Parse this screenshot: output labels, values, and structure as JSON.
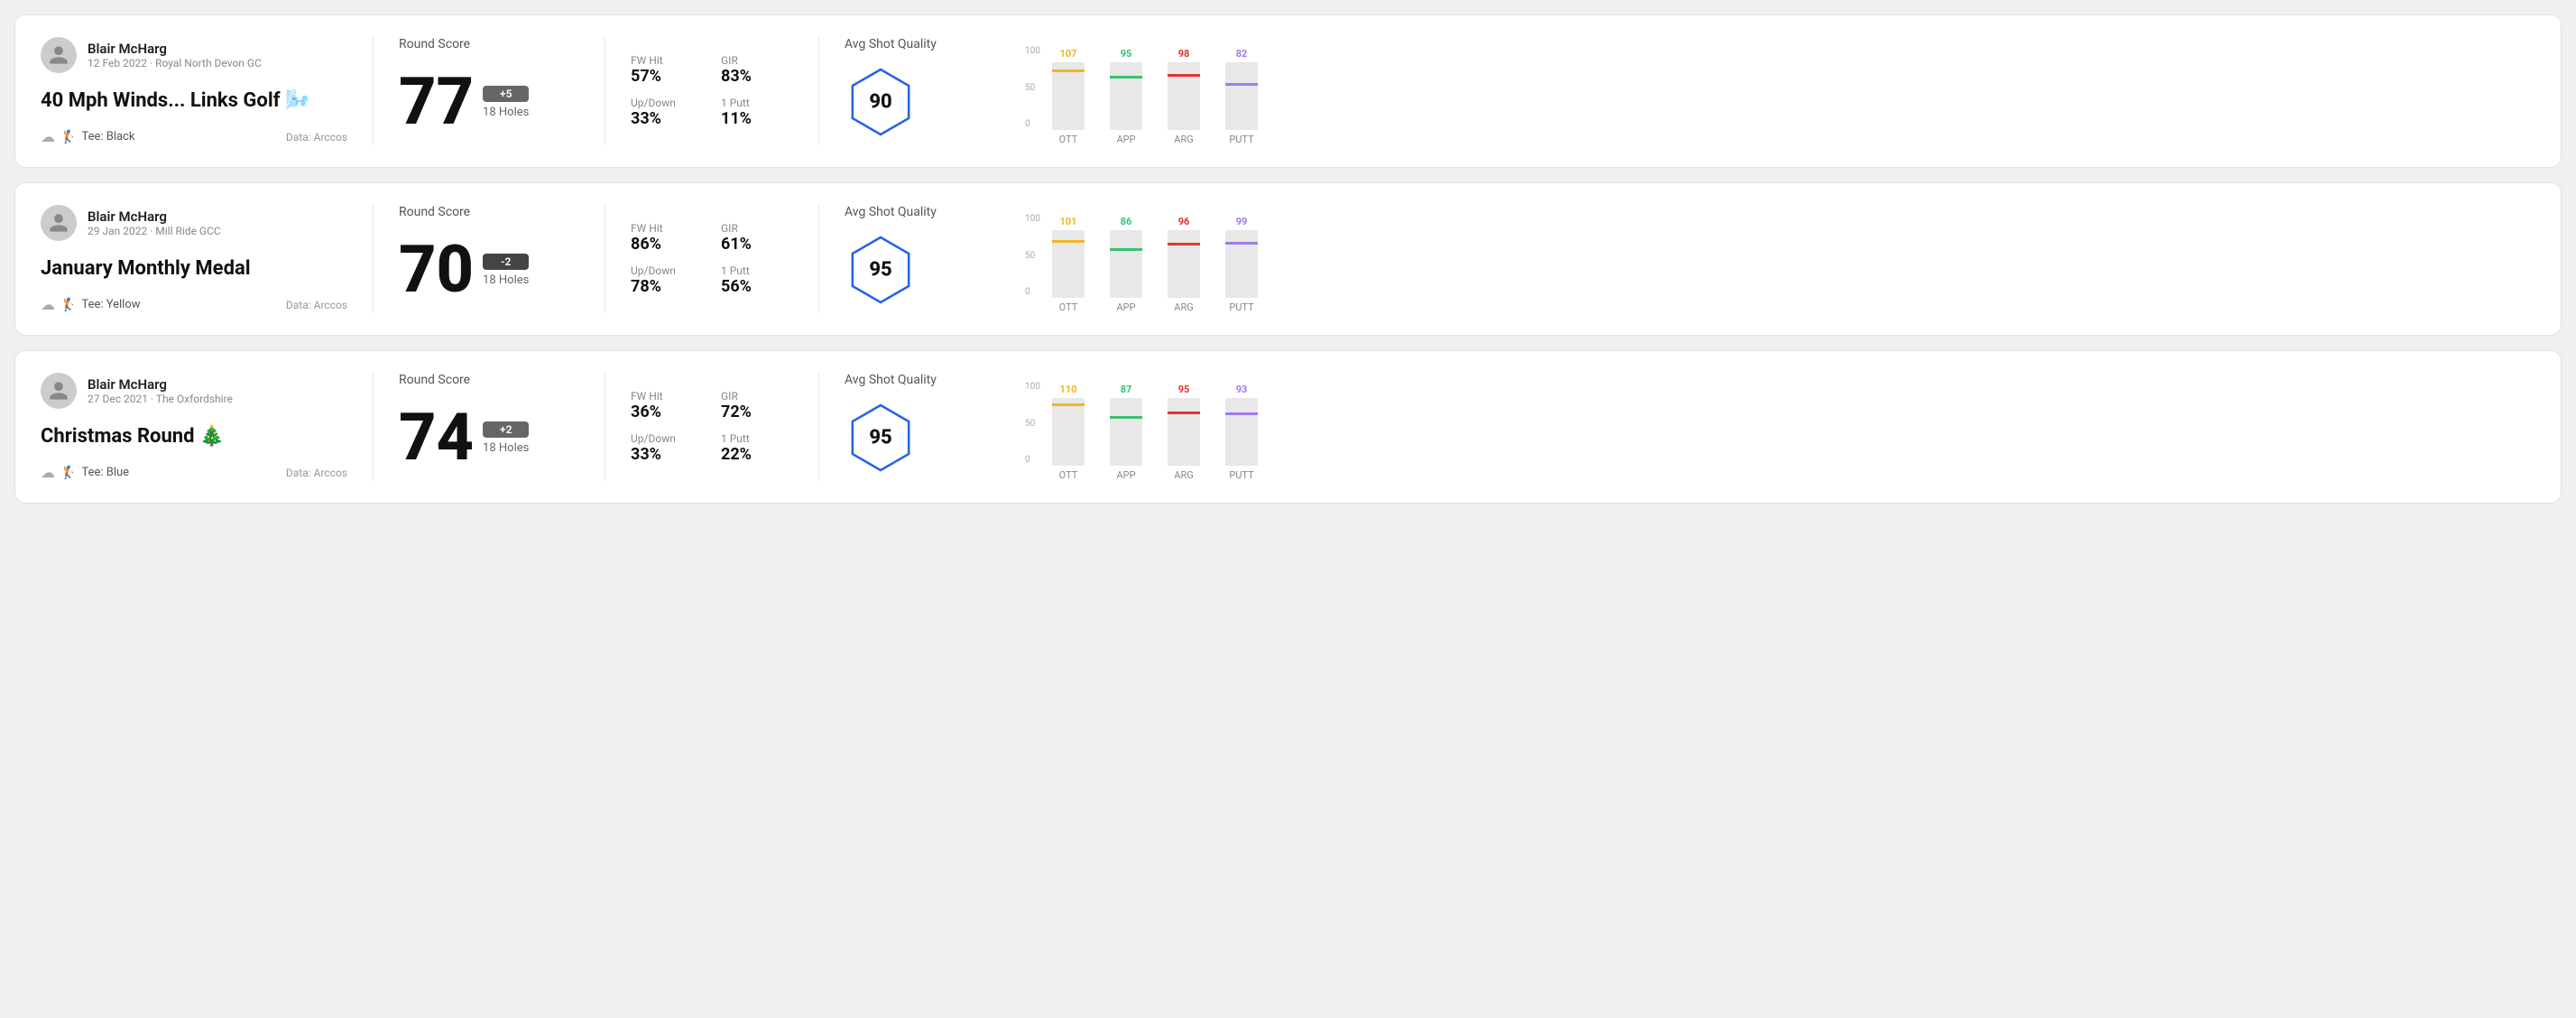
{
  "rounds": [
    {
      "id": "round-1",
      "user": {
        "name": "Blair McHarg",
        "date_course": "12 Feb 2022 · Royal North Devon GC"
      },
      "title": "40 Mph Winds... Links Golf 🌬️",
      "tee": "Black",
      "data_source": "Data: Arccos",
      "score": {
        "label": "Round Score",
        "number": "77",
        "badge": "+5",
        "badge_type": "positive",
        "holes": "18 Holes"
      },
      "stats": {
        "fw_hit_label": "FW Hit",
        "fw_hit_value": "57%",
        "gir_label": "GIR",
        "gir_value": "83%",
        "updown_label": "Up/Down",
        "updown_value": "33%",
        "oneputt_label": "1 Putt",
        "oneputt_value": "11%"
      },
      "quality": {
        "label": "Avg Shot Quality",
        "score": "90"
      },
      "chart": {
        "bars": [
          {
            "label": "OTT",
            "value": 107,
            "color": "#f0b429",
            "max": 125
          },
          {
            "label": "APP",
            "value": 95,
            "color": "#38c172",
            "max": 125
          },
          {
            "label": "ARG",
            "value": 98,
            "color": "#e3342f",
            "max": 125
          },
          {
            "label": "PUTT",
            "value": 82,
            "color": "#9f7aea",
            "max": 125
          }
        ],
        "y_labels": [
          "100",
          "50",
          "0"
        ]
      }
    },
    {
      "id": "round-2",
      "user": {
        "name": "Blair McHarg",
        "date_course": "29 Jan 2022 · Mill Ride GCC"
      },
      "title": "January Monthly Medal",
      "tee": "Yellow",
      "data_source": "Data: Arccos",
      "score": {
        "label": "Round Score",
        "number": "70",
        "badge": "-2",
        "badge_type": "negative",
        "holes": "18 Holes"
      },
      "stats": {
        "fw_hit_label": "FW Hit",
        "fw_hit_value": "86%",
        "gir_label": "GIR",
        "gir_value": "61%",
        "updown_label": "Up/Down",
        "updown_value": "78%",
        "oneputt_label": "1 Putt",
        "oneputt_value": "56%"
      },
      "quality": {
        "label": "Avg Shot Quality",
        "score": "95"
      },
      "chart": {
        "bars": [
          {
            "label": "OTT",
            "value": 101,
            "color": "#f0b429",
            "max": 125
          },
          {
            "label": "APP",
            "value": 86,
            "color": "#38c172",
            "max": 125
          },
          {
            "label": "ARG",
            "value": 96,
            "color": "#e3342f",
            "max": 125
          },
          {
            "label": "PUTT",
            "value": 99,
            "color": "#9f7aea",
            "max": 125
          }
        ],
        "y_labels": [
          "100",
          "50",
          "0"
        ]
      }
    },
    {
      "id": "round-3",
      "user": {
        "name": "Blair McHarg",
        "date_course": "27 Dec 2021 · The Oxfordshire"
      },
      "title": "Christmas Round 🎄",
      "tee": "Blue",
      "data_source": "Data: Arccos",
      "score": {
        "label": "Round Score",
        "number": "74",
        "badge": "+2",
        "badge_type": "positive",
        "holes": "18 Holes"
      },
      "stats": {
        "fw_hit_label": "FW Hit",
        "fw_hit_value": "36%",
        "gir_label": "GIR",
        "gir_value": "72%",
        "updown_label": "Up/Down",
        "updown_value": "33%",
        "oneputt_label": "1 Putt",
        "oneputt_value": "22%"
      },
      "quality": {
        "label": "Avg Shot Quality",
        "score": "95"
      },
      "chart": {
        "bars": [
          {
            "label": "OTT",
            "value": 110,
            "color": "#f0b429",
            "max": 125
          },
          {
            "label": "APP",
            "value": 87,
            "color": "#38c172",
            "max": 125
          },
          {
            "label": "ARG",
            "value": 95,
            "color": "#e3342f",
            "max": 125
          },
          {
            "label": "PUTT",
            "value": 93,
            "color": "#9f7aea",
            "max": 125
          }
        ],
        "y_labels": [
          "100",
          "50",
          "0"
        ]
      }
    }
  ]
}
